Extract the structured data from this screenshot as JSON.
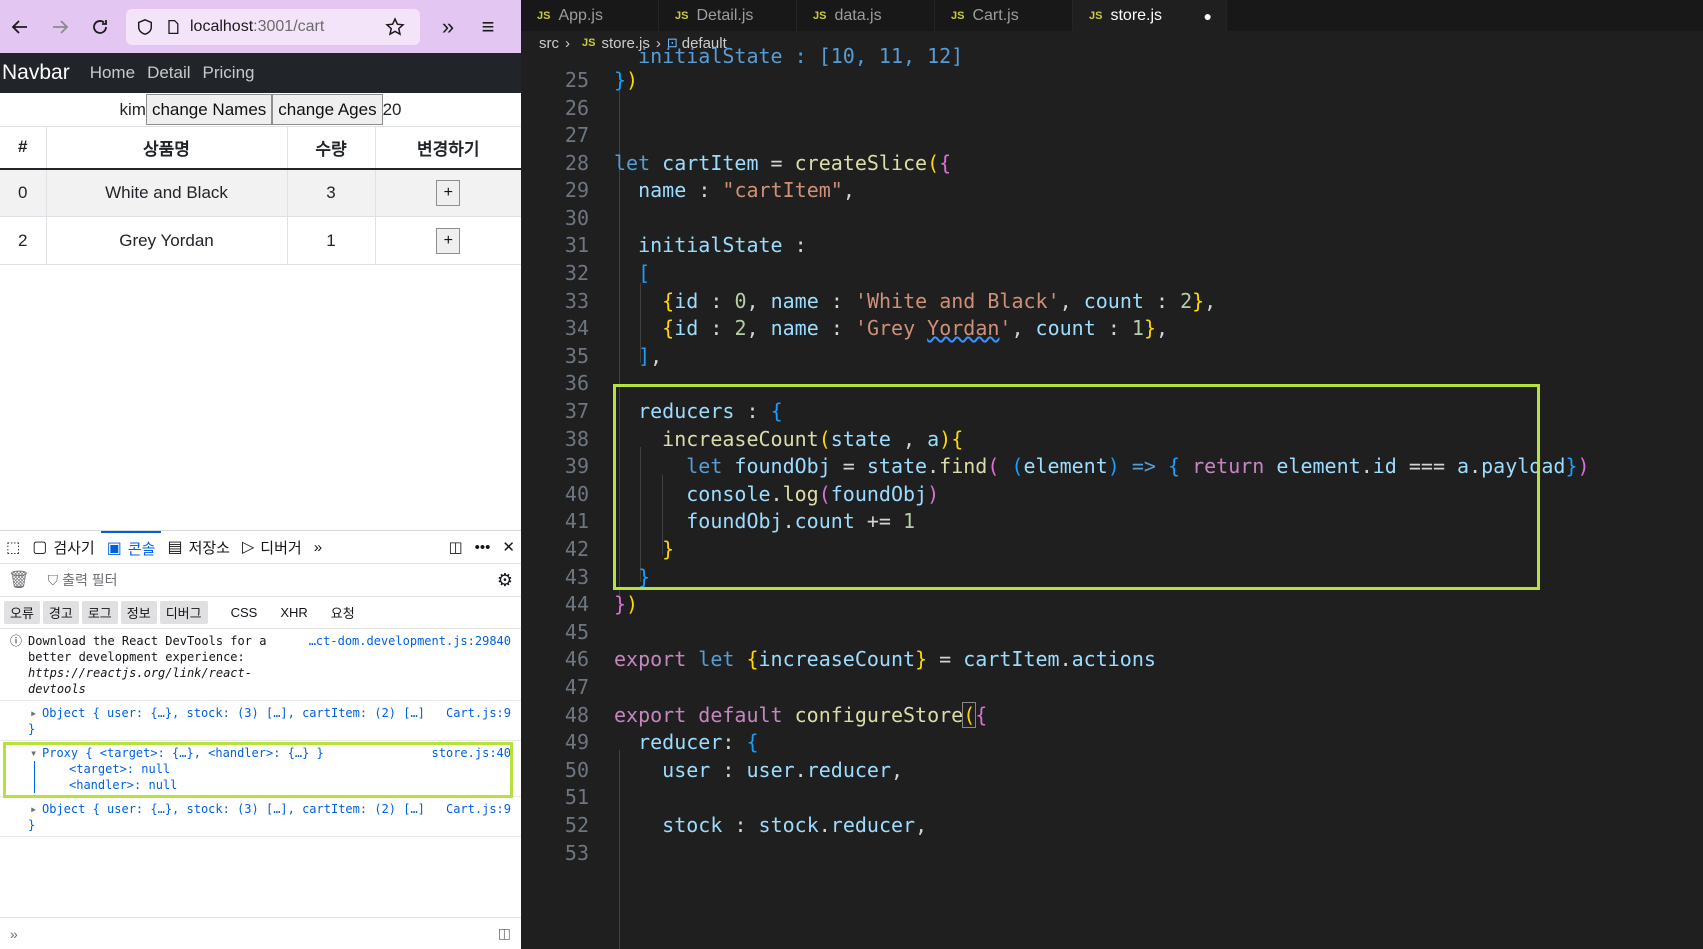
{
  "browser": {
    "url_host": "localhost",
    "url_path": ":3001/cart",
    "navbar": {
      "brand": "Navbar",
      "links": [
        "Home",
        "Detail",
        "Pricing"
      ]
    },
    "user_name": "kim",
    "change_names_label": "change Names",
    "change_ages_label": "change Ages",
    "user_age": "20",
    "table": {
      "headers": [
        "#",
        "상품명",
        "수량",
        "변경하기"
      ],
      "rows": [
        {
          "id": "0",
          "name": "White and Black",
          "qty": "3",
          "action": "+"
        },
        {
          "id": "2",
          "name": "Grey Yordan",
          "qty": "1",
          "action": "+"
        }
      ]
    }
  },
  "devtools": {
    "tabs": [
      "검사기",
      "콘솔",
      "저장소",
      "디버거"
    ],
    "filter_placeholder": "출력 필터",
    "levels": [
      "오류",
      "경고",
      "로그",
      "정보",
      "디버그"
    ],
    "extra_filters": [
      "CSS",
      "XHR",
      "요청"
    ],
    "messages": {
      "m1_line1": "Download the React DevTools for a",
      "m1_line2": "better development experience:",
      "m1_line3": "https://reactjs.org/link/react-",
      "m1_line4": "devtools",
      "m1_src": "…ct-dom.development.js:29840",
      "m2_text": "Object { user: {…}, stock: (3) […], cartItem: (2) […]",
      "m2_close": "}",
      "m2_src": "Cart.js:9",
      "m3_text": "Proxy { <target>: {…}, <handler>: {…} }",
      "m3_src": "store.js:40",
      "m3_target": "<target>: null",
      "m3_handler": "<handler>: null",
      "m4_text": "Object { user: {…}, stock: (3) […], cartItem: (2) […]",
      "m4_close": "}",
      "m4_src": "Cart.js:9"
    }
  },
  "editor": {
    "tabs": [
      "App.js",
      "Detail.js",
      "data.js",
      "Cart.js",
      "store.js"
    ],
    "breadcrumb": [
      "src",
      "store.js",
      "default"
    ],
    "line_numbers": [
      "25",
      "26",
      "27",
      "28",
      "29",
      "30",
      "31",
      "32",
      "33",
      "34",
      "35",
      "36",
      "37",
      "38",
      "39",
      "40",
      "41",
      "42",
      "43",
      "44",
      "45",
      "46",
      "47",
      "48",
      "49",
      "50",
      "51",
      "52",
      "53"
    ]
  },
  "colors": {
    "highlight": "#b6e33a",
    "editor_bg": "#1f1f1f",
    "url_bar": "#e4c6f2"
  }
}
